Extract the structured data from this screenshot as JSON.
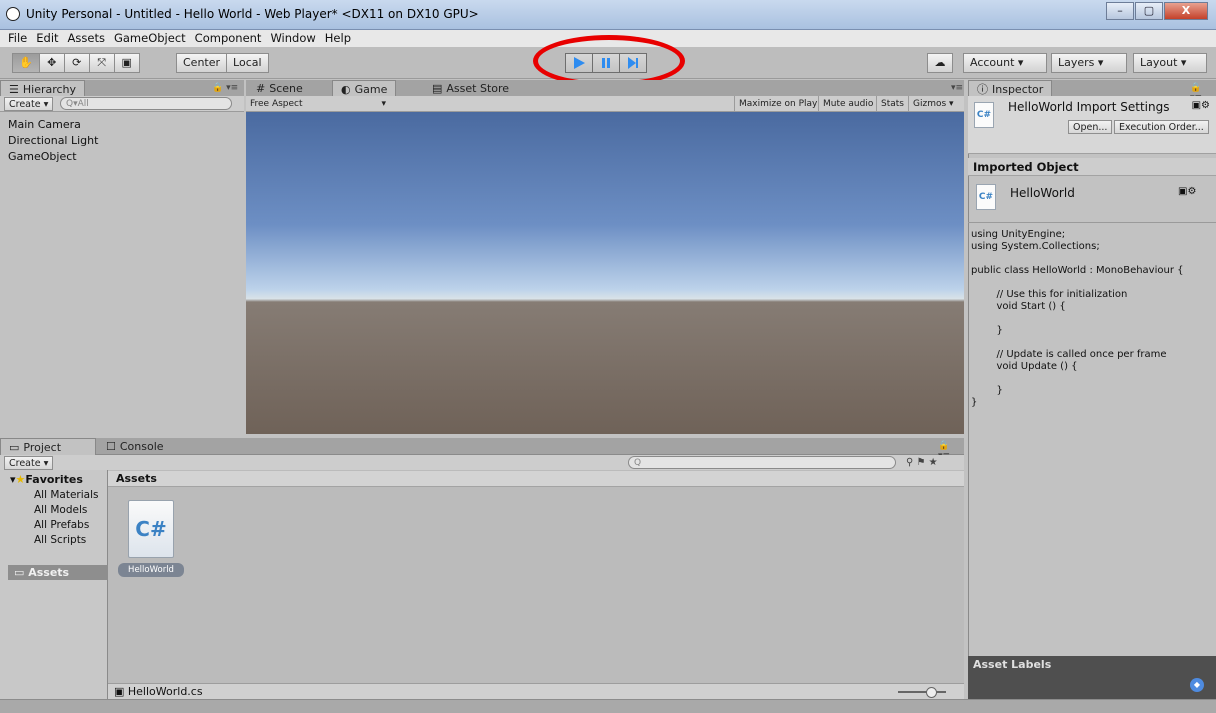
{
  "window": {
    "title": "Unity Personal - Untitled - Hello World - Web Player* <DX11 on DX10 GPU>",
    "controls": [
      "–",
      "▢",
      "X"
    ]
  },
  "menu": [
    "File",
    "Edit",
    "Assets",
    "GameObject",
    "Component",
    "Window",
    "Help"
  ],
  "toolbar": {
    "pivot_center": "Center",
    "pivot_local": "Local",
    "account": "Account",
    "layers": "Layers",
    "layout": "Layout",
    "play_state": {
      "play_active": true
    }
  },
  "hierarchy": {
    "tab": "Hierarchy",
    "create": "Create",
    "search_placeholder": "Q▾All",
    "items": [
      "Main Camera",
      "Directional Light",
      "GameObject"
    ]
  },
  "center": {
    "tabs": [
      "Scene",
      "Game",
      "Asset Store"
    ],
    "active_tab": "Game",
    "aspect": "Free Aspect",
    "options": [
      "Maximize on Play",
      "Mute audio",
      "Stats",
      "Gizmos"
    ]
  },
  "project": {
    "tabs": [
      "Project",
      "Console"
    ],
    "create": "Create",
    "favorites_label": "Favorites",
    "favorites": [
      "All Materials",
      "All Models",
      "All Prefabs",
      "All Scripts"
    ],
    "assets_folder": "Assets",
    "breadcrumb": "Assets",
    "file_name": "HelloWorld",
    "selected_path": "HelloWorld.cs"
  },
  "inspector": {
    "tab": "Inspector",
    "import_title": "HelloWorld Import Settings",
    "open_button": "Open...",
    "exec_order_button": "Execution Order...",
    "section": "Imported Object",
    "object_name": "HelloWorld",
    "code": "using UnityEngine;\nusing System.Collections;\n\npublic class HelloWorld : MonoBehaviour {\n\n\t// Use this for initialization\n\tvoid Start () {\n\n\t}\n\n\t// Update is called once per frame\n\tvoid Update () {\n\n\t}\n}",
    "asset_labels": "Asset Labels"
  }
}
